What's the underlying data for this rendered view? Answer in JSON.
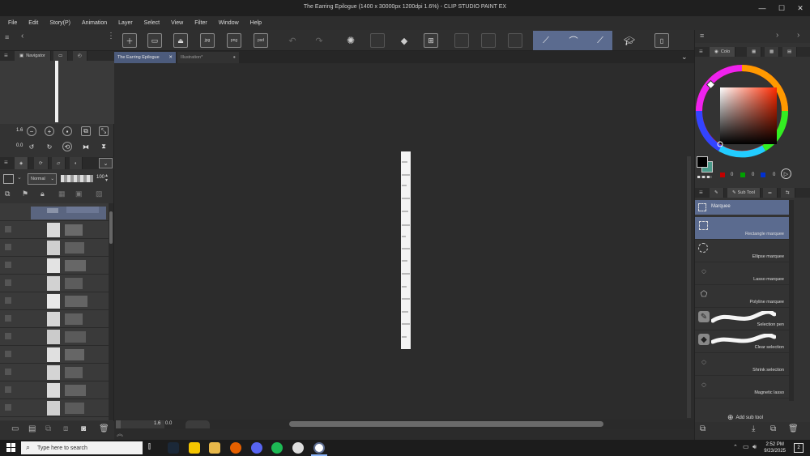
{
  "window": {
    "title": "The Earring Epilogue (1400 x 30000px 1200dpi 1.6%) - CLIP STUDIO PAINT EX",
    "minimize": "—",
    "maximize": "☐",
    "close": "✕"
  },
  "menu": [
    "File",
    "Edit",
    "Story(P)",
    "Animation",
    "Layer",
    "Select",
    "View",
    "Filter",
    "Window",
    "Help"
  ],
  "commandbar": {
    "file_labels": [
      "jpg",
      "png",
      "psd"
    ]
  },
  "navigator": {
    "tab_label": "Navigator",
    "zoom": "1.6",
    "rotation": "0.0"
  },
  "layers": {
    "blend_mode": "Normal",
    "opacity": "100"
  },
  "documents": {
    "tabs": [
      {
        "label": "The Earring Epilogue",
        "close": "✕",
        "active": true
      },
      {
        "label": "Illustration*",
        "close": "●",
        "active": false
      }
    ]
  },
  "status": {
    "zoom": "1.6",
    "rotation": "0.0"
  },
  "color": {
    "tab_label": "Colo",
    "rgb": [
      "0",
      "0",
      "0"
    ],
    "accent": "#5b6b8f"
  },
  "subtool": {
    "tab_label": "Sub Tool",
    "group_label": "Marquee",
    "items": [
      {
        "label": "Rectangle marquee",
        "selected": true
      },
      {
        "label": "Ellipse marquee",
        "selected": false
      },
      {
        "label": "Lasso marquee",
        "selected": false
      },
      {
        "label": "Polyline marquee",
        "selected": false
      },
      {
        "label": "Selection pen",
        "selected": false
      },
      {
        "label": "Clear selection",
        "selected": false
      },
      {
        "label": "Shrink selection",
        "selected": false
      },
      {
        "label": "Magnetic lasso",
        "selected": false
      }
    ],
    "add_label": "Add sub tool"
  },
  "taskbar": {
    "search_placeholder": "Type here to search",
    "time": "2:52 PM",
    "date": "9/23/2025",
    "notification_count": "2"
  }
}
